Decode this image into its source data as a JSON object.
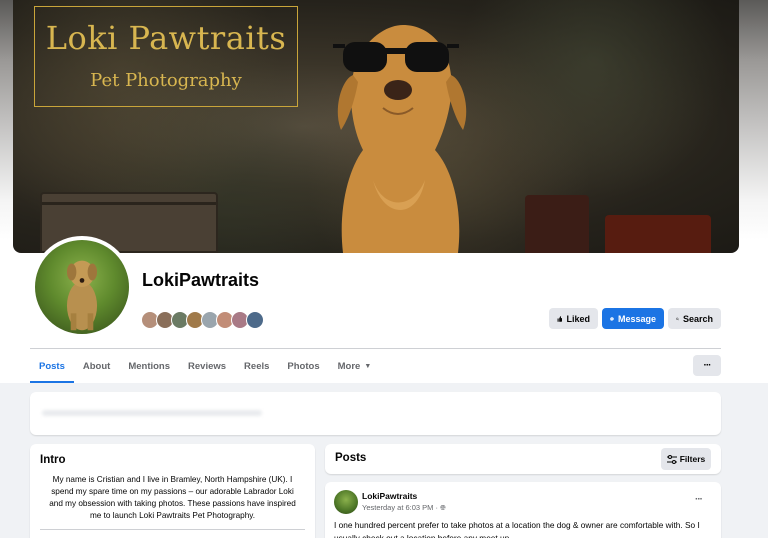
{
  "cover": {
    "logo_title": "Loki Pawtraits",
    "logo_subtitle": "Pet Photography"
  },
  "profile": {
    "name": "LokiPawtraits",
    "follower_avatar_colors": [
      "#b58f7a",
      "#8a6f5a",
      "#6b7b64",
      "#a07a4a",
      "#9aa5ad",
      "#c28d77",
      "#a97a86",
      "#4d6a8a"
    ]
  },
  "actions": {
    "liked_label": "Liked",
    "message_label": "Message",
    "search_label": "Search"
  },
  "tabs": [
    {
      "label": "Posts",
      "active": true
    },
    {
      "label": "About"
    },
    {
      "label": "Mentions"
    },
    {
      "label": "Reviews"
    },
    {
      "label": "Reels"
    },
    {
      "label": "Photos"
    },
    {
      "label": "More"
    }
  ],
  "more_menu_label": "···",
  "intro": {
    "title": "Intro",
    "text": "My name is Cristian and I live in Bramley, North Hampshire (UK). I spend my spare time on my passions – our adorable Labrador Loki and my obsession with taking photos. These passions have inspired me to launch Loki Pawtraits Pet Photography."
  },
  "posts_section": {
    "title": "Posts",
    "filters_label": "Filters"
  },
  "post": {
    "author": "LokiPawtraits",
    "time": "Yesterday at 6:03 PM ·",
    "text": "I one hundred percent prefer to take photos at a location the dog & owner are comfortable with. So I usually check out a location before any meet up.",
    "menu": "···"
  },
  "colors": {
    "accent": "#1b74e4",
    "logo_gold": "#d8b650"
  }
}
